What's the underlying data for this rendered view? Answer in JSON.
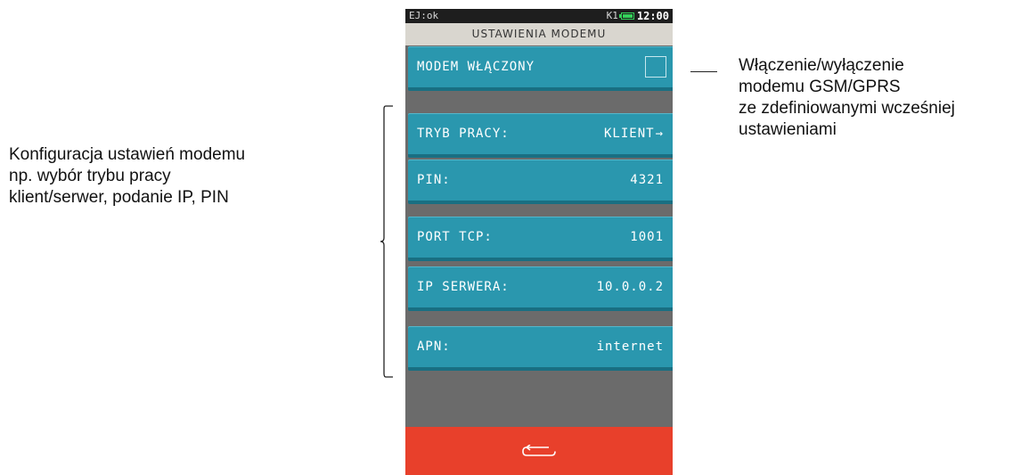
{
  "annotations": {
    "left": [
      "Konfiguracja ustawień modemu",
      "np. wybór trybu pracy",
      "klient/serwer, podanie IP, PIN"
    ],
    "right": [
      "Włączenie/wyłączenie",
      "modemu GSM/GPRS",
      "ze zdefiniowanymi wcześniej",
      "ustawieniami"
    ]
  },
  "device": {
    "status": {
      "left": "EJ:ok",
      "mode": "K1",
      "time": "12:00"
    },
    "title": "USTAWIENIA MODEMU",
    "rows": [
      {
        "label": "MODEM WŁĄCZONY",
        "value": "",
        "type": "checkbox",
        "checked": false
      },
      {
        "label": "TRYB PRACY:",
        "value": "KLIENT",
        "type": "link",
        "arrow": "→"
      },
      {
        "label": "PIN:",
        "value": "4321",
        "type": "value"
      },
      {
        "label": "PORT TCP:",
        "value": "1001",
        "type": "value"
      },
      {
        "label": "IP SERWERA:",
        "value": "10.0.0.2",
        "type": "value"
      },
      {
        "label": "APN:",
        "value": "internet",
        "type": "value"
      }
    ],
    "bottom_icon": "back-arrow-icon",
    "colors": {
      "row": "#2a97ae",
      "title_bar": "#d9d6cf",
      "bottom_bar": "#e8402b",
      "status_bar": "#1e1e1e",
      "battery": "#34d35a"
    }
  }
}
